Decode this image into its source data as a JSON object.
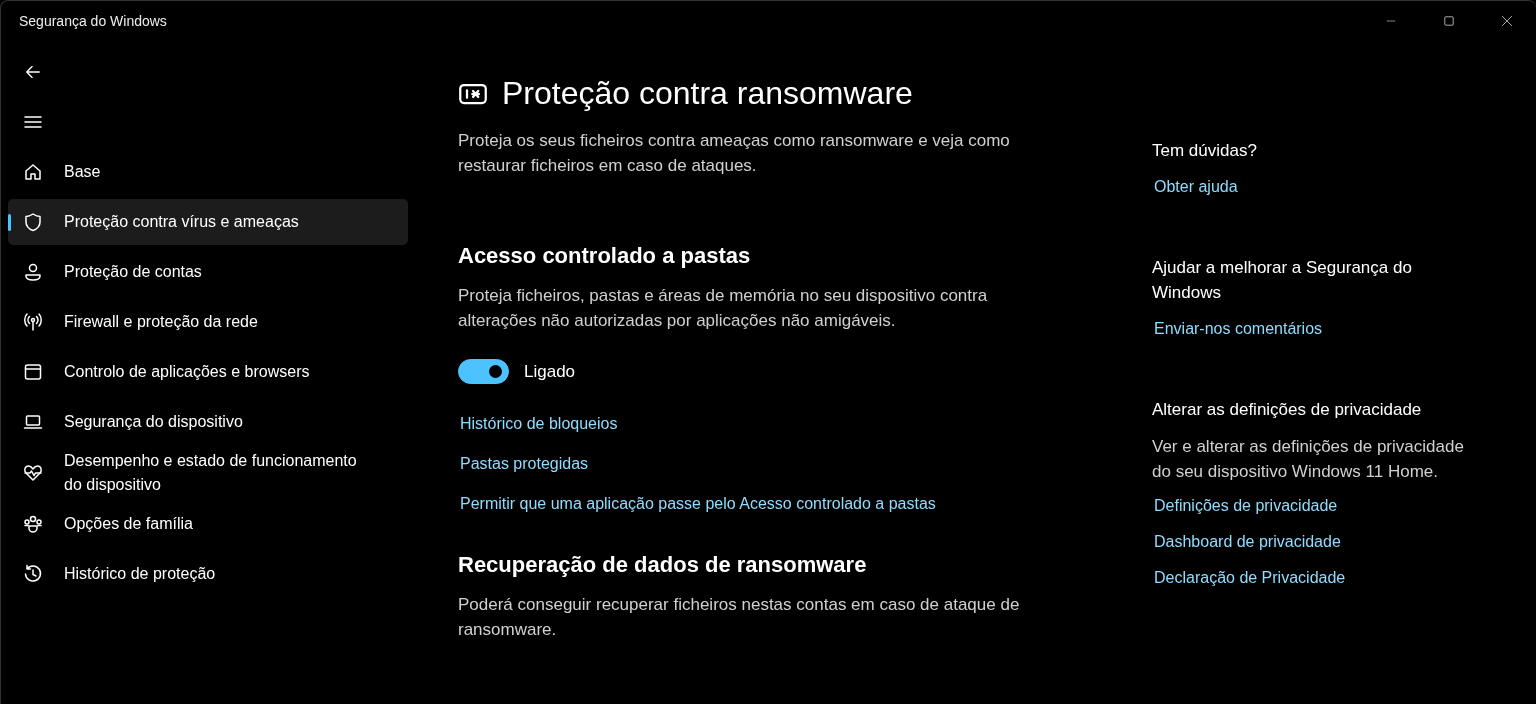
{
  "window": {
    "title": "Segurança do Windows"
  },
  "sidebar": {
    "items": [
      {
        "label": "Base",
        "selected": false
      },
      {
        "label": "Proteção contra vírus e ameaças",
        "selected": true
      },
      {
        "label": "Proteção de contas",
        "selected": false
      },
      {
        "label": "Firewall e proteção da rede",
        "selected": false
      },
      {
        "label": "Controlo de aplicações e browsers",
        "selected": false
      },
      {
        "label": "Segurança do dispositivo",
        "selected": false
      },
      {
        "label": "Desempenho e estado de funcionamento do dispositivo",
        "selected": false
      },
      {
        "label": "Opções de família",
        "selected": false
      },
      {
        "label": "Histórico de proteção",
        "selected": false
      }
    ]
  },
  "page": {
    "title": "Proteção contra ransomware",
    "description": "Proteja os seus ficheiros contra ameaças como ransomware e veja como restaurar ficheiros em caso de ataques.",
    "sections": [
      {
        "heading": "Acesso controlado a pastas",
        "description": "Proteja ficheiros, pastas e áreas de memória no seu dispositivo contra alterações não autorizadas por aplicações não amigáveis.",
        "toggle": {
          "on": true,
          "label": "Ligado"
        },
        "links": [
          "Histórico de bloqueios",
          "Pastas protegidas",
          "Permitir que uma aplicação passe pelo Acesso controlado a pastas"
        ]
      },
      {
        "heading": "Recuperação de dados de ransomware",
        "description": "Poderá conseguir recuperar ficheiros nestas contas em caso de ataque de ransomware."
      }
    ]
  },
  "aside": [
    {
      "heading": "Tem dúvidas?",
      "links": [
        "Obter ajuda"
      ]
    },
    {
      "heading": "Ajudar a melhorar a Segurança do Windows",
      "links": [
        "Enviar-nos comentários"
      ]
    },
    {
      "heading": "Alterar as definições de privacidade",
      "text": "Ver e alterar as definições de privacidade do seu dispositivo Windows 11 Home.",
      "links": [
        "Definições de privacidade",
        "Dashboard de privacidade",
        "Declaração de Privacidade"
      ]
    }
  ]
}
